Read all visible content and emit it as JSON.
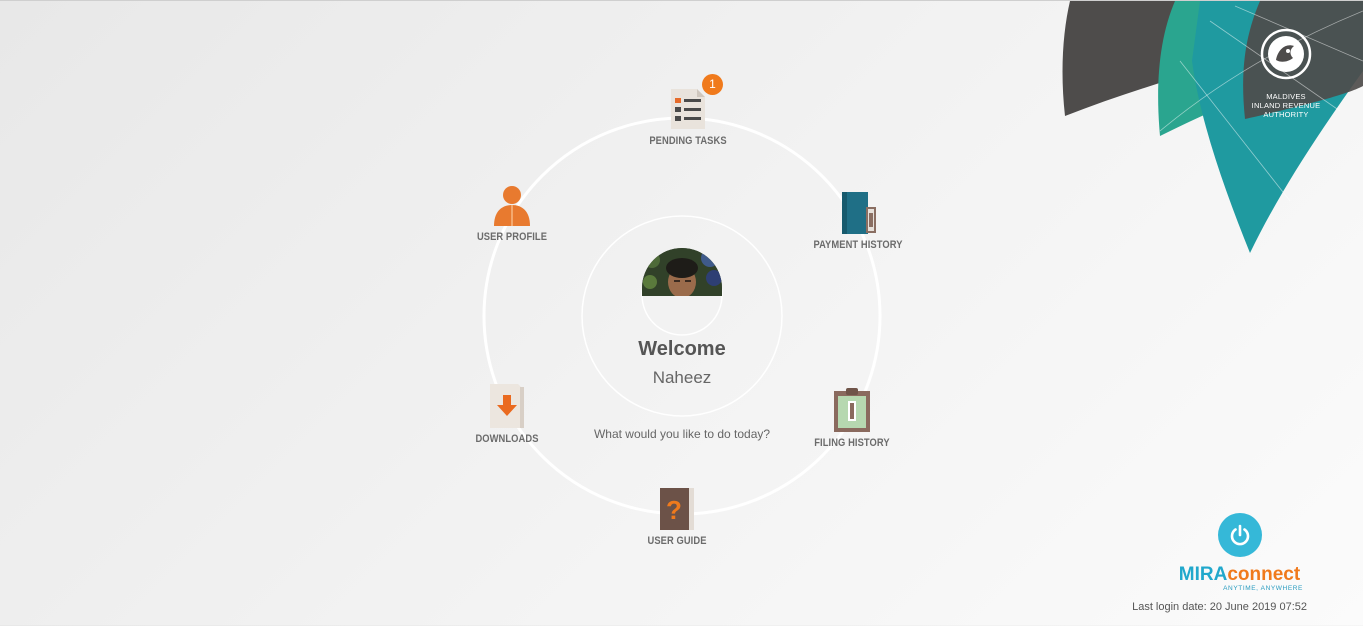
{
  "authority": {
    "line1": "MALDIVES",
    "line2": "INLAND REVENUE",
    "line3": "AUTHORITY"
  },
  "menu": {
    "pending_tasks": {
      "label": "PENDING TASKS",
      "badge": "1",
      "icon": "task-list-icon"
    },
    "payment_history": {
      "label": "PAYMENT HISTORY",
      "icon": "ledger-book-icon"
    },
    "filing_history": {
      "label": "FILING HISTORY",
      "icon": "clipboard-icon"
    },
    "user_guide": {
      "label": "USER GUIDE",
      "icon": "help-book-icon"
    },
    "downloads": {
      "label": "DOWNLOADS",
      "icon": "download-icon"
    },
    "user_profile": {
      "label": "USER PROFILE",
      "icon": "user-icon"
    }
  },
  "welcome": {
    "title": "Welcome",
    "name": "Naheez",
    "prompt": "What would you like to do today?"
  },
  "brand": {
    "name_part1": "MIRA",
    "name_part2": "connect",
    "tagline": "ANYTIME, ANYWHERE",
    "power_icon": "power-icon"
  },
  "footer": {
    "last_login": "Last login date: 20 June 2019 07:52"
  },
  "colors": {
    "accent_orange": "#f07a1c",
    "accent_teal": "#21a8cc",
    "dark_gray": "#4e4c4b",
    "green_teal": "#2aa58f"
  }
}
